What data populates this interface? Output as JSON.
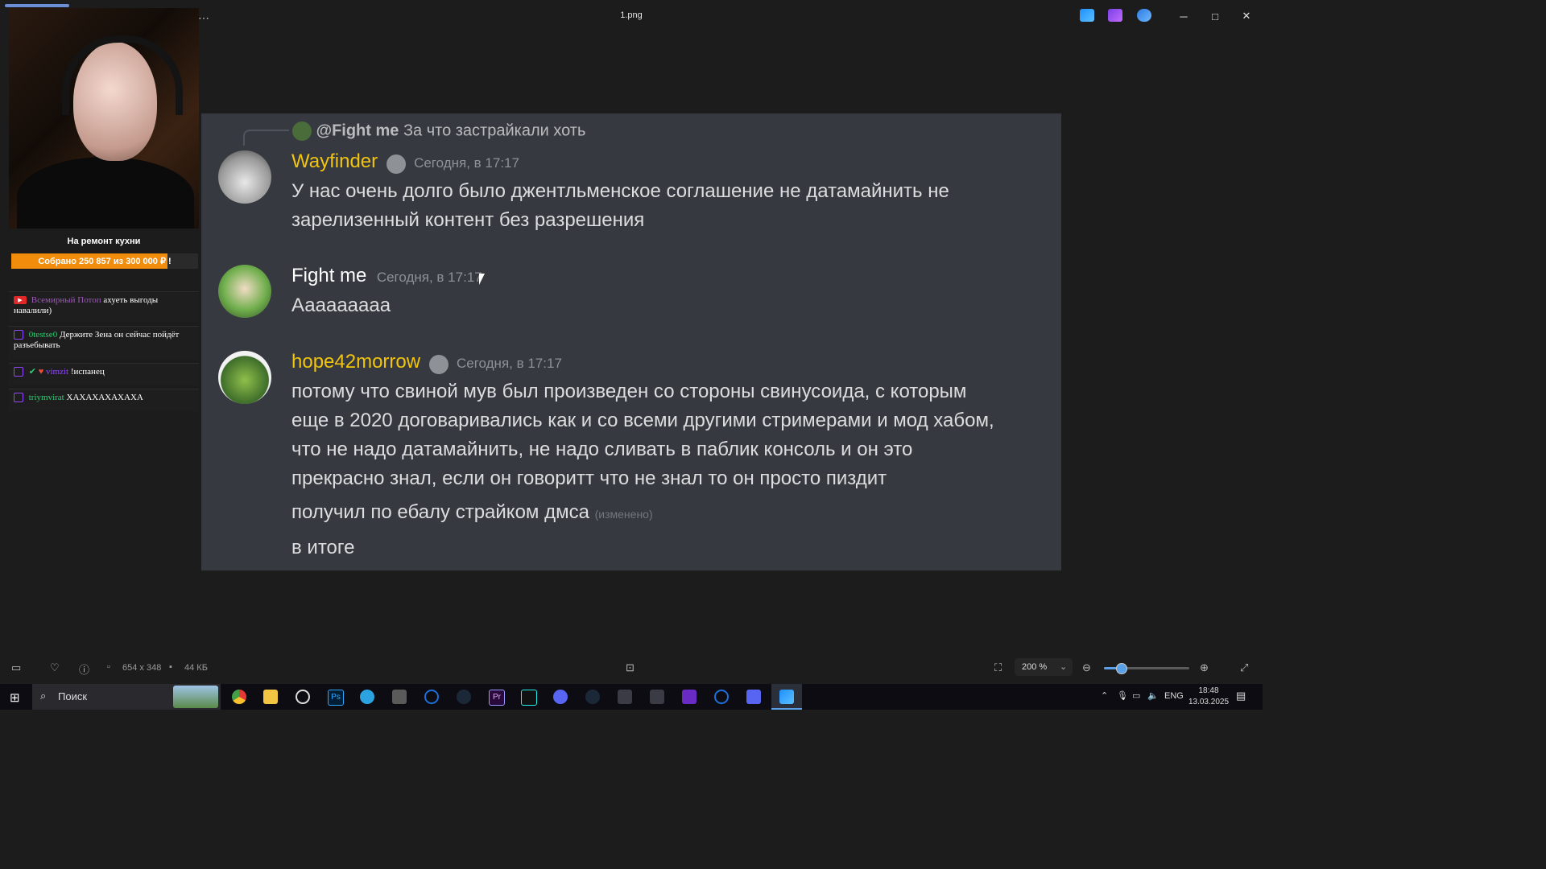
{
  "window": {
    "title": "1.png",
    "minimize": "─",
    "maximize": "□",
    "close": "✕"
  },
  "overlay": {
    "menu_dots": "⋯",
    "goal_title": "На ремонт кухни",
    "goal_text": "Собрано 250 857  из 300 000 ₽ !",
    "goal_fraction": 0.836,
    "goal_color": "#f18c0c",
    "chat": [
      {
        "user": "Всемирный Потоп",
        "text": "ахуеть выгоды навалили)",
        "platform": "youtube",
        "user_color": "#9b59b6"
      },
      {
        "user": "0testse0",
        "text": "Держите Зена он сейчас пойдёт разъебывать",
        "platform": "twitch",
        "user_color": "#2ecc71"
      },
      {
        "user": "vimzit",
        "text": "!испанец",
        "platform": "twitch",
        "user_color": "#9146ff"
      },
      {
        "user": "triymvirat",
        "text": "ХАХАХАХАХАХА",
        "platform": "twitch",
        "user_color": "#2ecc71"
      }
    ]
  },
  "discord": {
    "reply": {
      "mention": "@Fight me",
      "text": "За что застрайкали хоть"
    },
    "messages": [
      {
        "author": "Wayfinder",
        "color": "#f1c40f",
        "time": "Сегодня, в 17:17",
        "lines": [
          "У нас очень долго было джентльменское соглашение не датамайнить не",
          "зарелизенный контент без разрешения"
        ]
      },
      {
        "author": "Fight me",
        "color": "#ffffff",
        "time": "Сегодня, в 17:17",
        "lines": [
          "Ааааааааа"
        ]
      },
      {
        "author": "hope42morrow",
        "color": "#f1c40f",
        "time": "Сегодня, в 17:17",
        "lines": [
          "потому что свиной мув был произведен со стороны свинусоида, с которым",
          "еще в 2020 договаривались как и со всеми другими стримерами и мод хабом,",
          "что не надо датамайнить, не надо  сливать в паблик консоль  и он это",
          "прекрасно знал, если он говоритт что не знал то он просто пиздит"
        ],
        "edited_line": "получил по ебалу страйком дмса",
        "edited_tag": "(изменено)",
        "last_line": "в итоге"
      }
    ]
  },
  "toolbar": {
    "dimensions": "654 x 348",
    "size": "44 КБ",
    "zoom": "200 %",
    "zoom_level": 0.2
  },
  "taskbar": {
    "search_placeholder": "Поиск",
    "lang": "ENG",
    "time": "18:48",
    "date": "13.03.2025"
  }
}
